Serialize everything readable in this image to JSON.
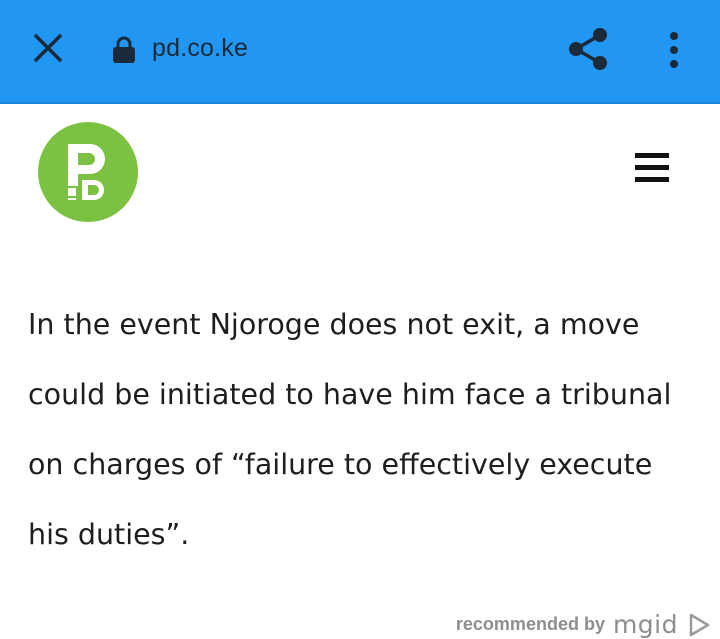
{
  "browser": {
    "url": "pd.co.ke",
    "icons": {
      "close": "close-icon",
      "lock": "lock-icon",
      "share": "share-icon",
      "menu": "more-vert-icon"
    },
    "bar_color": "#2196f3"
  },
  "site": {
    "logo_icon": "pd-logo",
    "logo_color": "#7cc142",
    "menu_icon": "hamburger-icon"
  },
  "article": {
    "paragraph": "In the event Njoroge does not exit, a move could be initiated to have him face a tribunal on charges of “failure to effectively execute his duties”."
  },
  "ad": {
    "label": "recommended by",
    "brand": "mgid",
    "icon": "play-icon"
  }
}
